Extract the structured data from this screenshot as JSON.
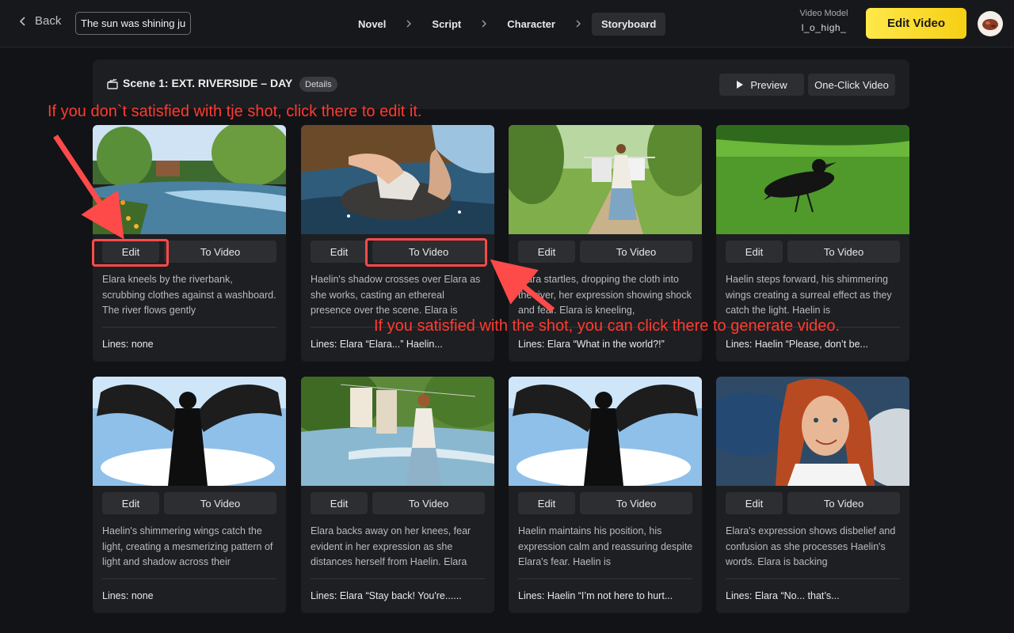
{
  "topbar": {
    "back_label": "Back",
    "title_value": "The sun was shining jus",
    "steps": [
      "Novel",
      "Script",
      "Character",
      "Storyboard"
    ],
    "active_step": "Storyboard",
    "model_label": "Video Model",
    "model_value": "l_o_high_",
    "edit_video_label": "Edit Video"
  },
  "scene": {
    "title": "Scene 1: EXT. RIVERSIDE – DAY",
    "details_label": "Details",
    "preview_label": "Preview",
    "one_click_label": "One-Click Video"
  },
  "shots": [
    {
      "edit_label": "Edit",
      "to_video_label": "To Video",
      "description": "Elara kneels by the riverbank, scrubbing clothes against a washboard. The river flows gently",
      "lines": "Lines:  none"
    },
    {
      "edit_label": "Edit",
      "to_video_label": "To Video",
      "description": "Haelin's shadow crosses over Elara as she works, casting an ethereal presence over the scene. Elara is",
      "lines": "Lines: Elara “Elara...”   Haelin..."
    },
    {
      "edit_label": "Edit",
      "to_video_label": "To Video",
      "description": "Elara startles, dropping the cloth into the river, her expression showing shock and fear. Elara is kneeling,",
      "lines": "Lines: Elara “What in the world?!”"
    },
    {
      "edit_label": "Edit",
      "to_video_label": "To Video",
      "description": "Haelin steps forward, his shimmering wings creating a surreal effect as they catch the light. Haelin is",
      "lines": "Lines: Haelin “Please, don’t be..."
    },
    {
      "edit_label": "Edit",
      "to_video_label": "To Video",
      "description": "Haelin's shimmering wings catch the light, creating a mesmerizing pattern of light and shadow across their",
      "lines": "Lines:  none"
    },
    {
      "edit_label": "Edit",
      "to_video_label": "To Video",
      "description": "Elara backs away on her knees, fear evident in her expression as she distances herself from Haelin. Elara",
      "lines": "Lines: Elara “Stay back! You're......"
    },
    {
      "edit_label": "Edit",
      "to_video_label": "To Video",
      "description": "Haelin maintains his position, his expression calm and reassuring despite Elara's fear. Haelin is",
      "lines": "Lines: Haelin “I’m not here to hurt..."
    },
    {
      "edit_label": "Edit",
      "to_video_label": "To Video",
      "description": "Elara's expression shows disbelief and confusion as she processes Haelin's words. Elara is backing",
      "lines": "Lines: Elara “No... that’s..."
    }
  ],
  "annotations": {
    "edit_hint": "If you don`t satisfied with tje shot, click there to edit it.",
    "video_hint": "If you satisfied with the shot, you can click there to generate video.",
    "color": "#ff3b30"
  },
  "colors": {
    "accent": "#f6cf14",
    "background": "#121316",
    "card": "#1e1f22"
  }
}
